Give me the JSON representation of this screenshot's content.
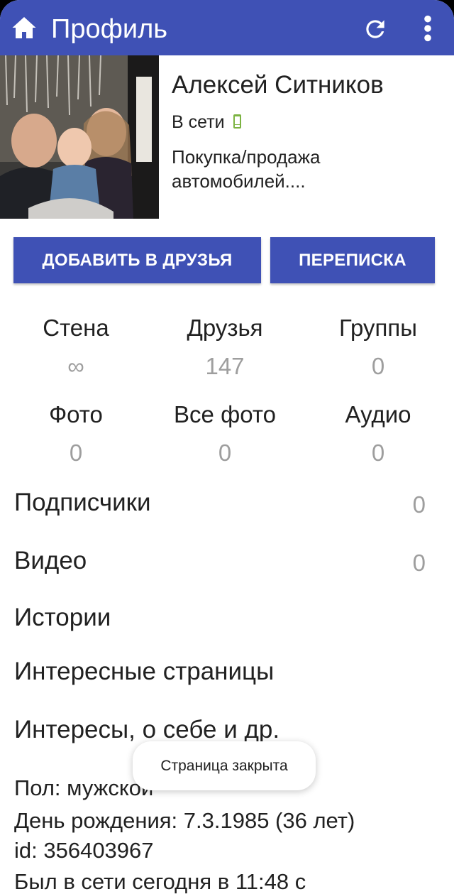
{
  "appbar": {
    "title": "Профиль",
    "home_icon": "home-icon",
    "refresh_icon": "refresh-icon",
    "menu_icon": "more-vert-icon",
    "color": "#3f51b5"
  },
  "profile": {
    "name": "Алексей Ситников",
    "online": "В сети",
    "online_icon": "mobile-phone-icon",
    "status": "Покупка/продажа автомобилей...."
  },
  "actions": {
    "add_friend": "ДОБАВИТЬ В ДРУЗЬЯ",
    "messages": "ПЕРЕПИСКА"
  },
  "counters": [
    {
      "label": "Стена",
      "value": "∞"
    },
    {
      "label": "Друзья",
      "value": "147"
    },
    {
      "label": "Группы",
      "value": "0"
    },
    {
      "label": "Фото",
      "value": "0"
    },
    {
      "label": "Все фото",
      "value": "0"
    },
    {
      "label": "Аудио",
      "value": "0"
    }
  ],
  "rows": [
    {
      "label": "Подписчики",
      "value": "0"
    },
    {
      "label": "Видео",
      "value": "0"
    },
    {
      "label": "Истории",
      "value": ""
    },
    {
      "label": "Интересные страницы",
      "value": ""
    },
    {
      "label": "Интересы, о себе и др.",
      "value": ""
    }
  ],
  "info": {
    "gender": "Пол: мужской",
    "birthday": "День рождения: 7.3.1985 (36 лет)",
    "id": "id: 356403967",
    "last_seen": "Был в сети сегодня в 11:48 с"
  },
  "toast": "Страница закрыта"
}
